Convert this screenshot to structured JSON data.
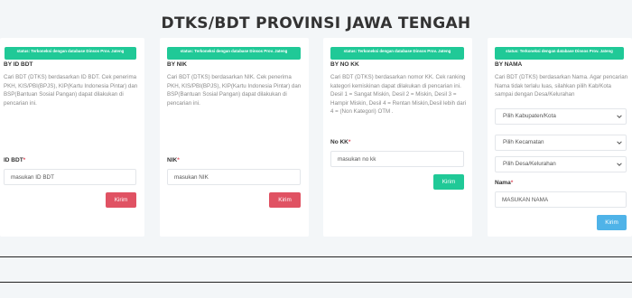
{
  "page": {
    "title": "DTKS/BDT PROVINSI JAWA TENGAH"
  },
  "status_badge": "status: Terkoneksi dengan database Dinsos Prov. Jateng",
  "cards": {
    "bdt": {
      "title": "BY ID BDT",
      "desc": "Cari BDT (DTKS) berdasarkan ID BDT. Cek penerima PKH, KIS/PBI(BPJS), KIP(Kartu Indonesia Pintar) dan BSP(Bantuan Sosial Pangan) dapat dilakukan di pencarian ini.",
      "field_label": "ID BDT",
      "placeholder": "masukan ID BDT",
      "button": "Kirim"
    },
    "nik": {
      "title": "BY NIK",
      "desc": "Cari BDT (DTKS) berdasarkan NIK. Cek penerima PKH, KIS/PBI(BPJS), KIP(Kartu Indonesia Pintar) dan BSP(Bantuan Sosial Pangan) dapat dilakukan di pencarian ini.",
      "field_label": "NIK",
      "placeholder": "masukan NIK",
      "button": "Kirim"
    },
    "nokk": {
      "title": "BY NO KK",
      "desc": "Cari BDT (DTKS) berdasarkan nomor KK. Cek ranking kategori kemiskinan dapat dilakukan di pencarian ini. Desil 1 = Sangat Miskin, Desil 2 = Miskin, Desil 3 = Hampir Miskin, Desil 4 = Rentan Miskin,Desil lebih dari 4 = (Non Kategori) OTM .",
      "field_label": "No KK",
      "placeholder": "masukan no kk",
      "button": "Kirim"
    },
    "nama": {
      "title": "BY NAMA",
      "desc": "Cari BDT (DTKS) berdasarkan Nama. Agar pencarian Nama tidak terlalu luas, silahkan pilih Kab/Kota sampai dengan Desa/Kelurahan",
      "select_kab": "Pilih Kabupaten/Kota",
      "select_kec": "Pilih Kecamatan",
      "select_desa": "Pilih Desa/Kelurahan",
      "field_label": "Nama",
      "placeholder": "MASUKAN NAMA",
      "button": "Kirim"
    }
  },
  "colors": {
    "red": "#e05263",
    "green": "#20c997",
    "blue": "#4fb3e8"
  },
  "icons": {
    "select_arrow": "chevron-down-icon"
  }
}
